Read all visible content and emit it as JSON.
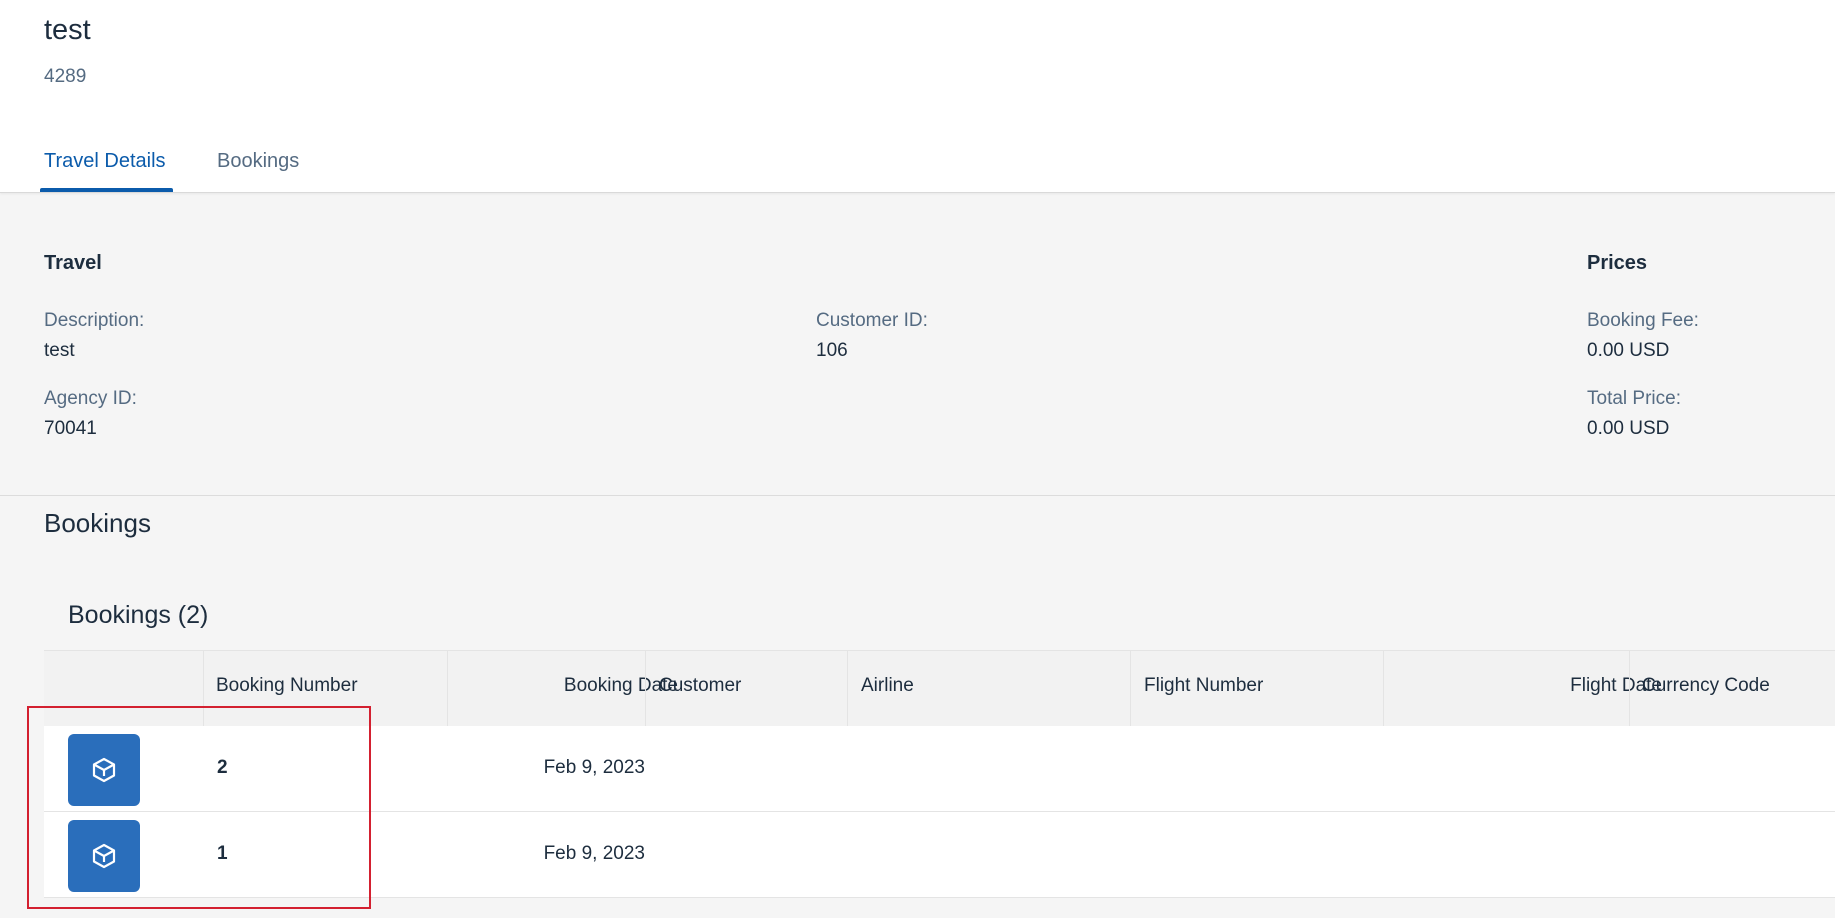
{
  "header": {
    "title": "test",
    "subtitle": "4289"
  },
  "tabs": [
    {
      "label": "Travel Details",
      "active": true
    },
    {
      "label": "Bookings",
      "active": false
    }
  ],
  "travel_section": {
    "heading": "Travel",
    "description_label": "Description:",
    "description_value": "test",
    "agency_label": "Agency ID:",
    "agency_value": "70041",
    "customer_label": "Customer ID:",
    "customer_value": "106"
  },
  "prices_section": {
    "heading": "Prices",
    "fee_label": "Booking Fee:",
    "fee_value": "0.00 USD",
    "total_label": "Total Price:",
    "total_value": "0.00 USD"
  },
  "bookings_section": {
    "title": "Bookings",
    "table_title": "Bookings (2)",
    "columns": [
      "Booking Number",
      "Booking Date",
      "Customer",
      "Airline",
      "Flight Number",
      "Flight Date",
      "Currency Code"
    ],
    "rows": [
      {
        "booking_number": "2",
        "booking_date": "Feb 9, 2023",
        "icon": "product-box-icon"
      },
      {
        "booking_number": "1",
        "booking_date": "Feb 9, 2023",
        "icon": "product-box-icon"
      }
    ]
  },
  "colors": {
    "accent": "#0b5bab",
    "icon_tile": "#2a6ebb",
    "highlight": "#d32030"
  }
}
